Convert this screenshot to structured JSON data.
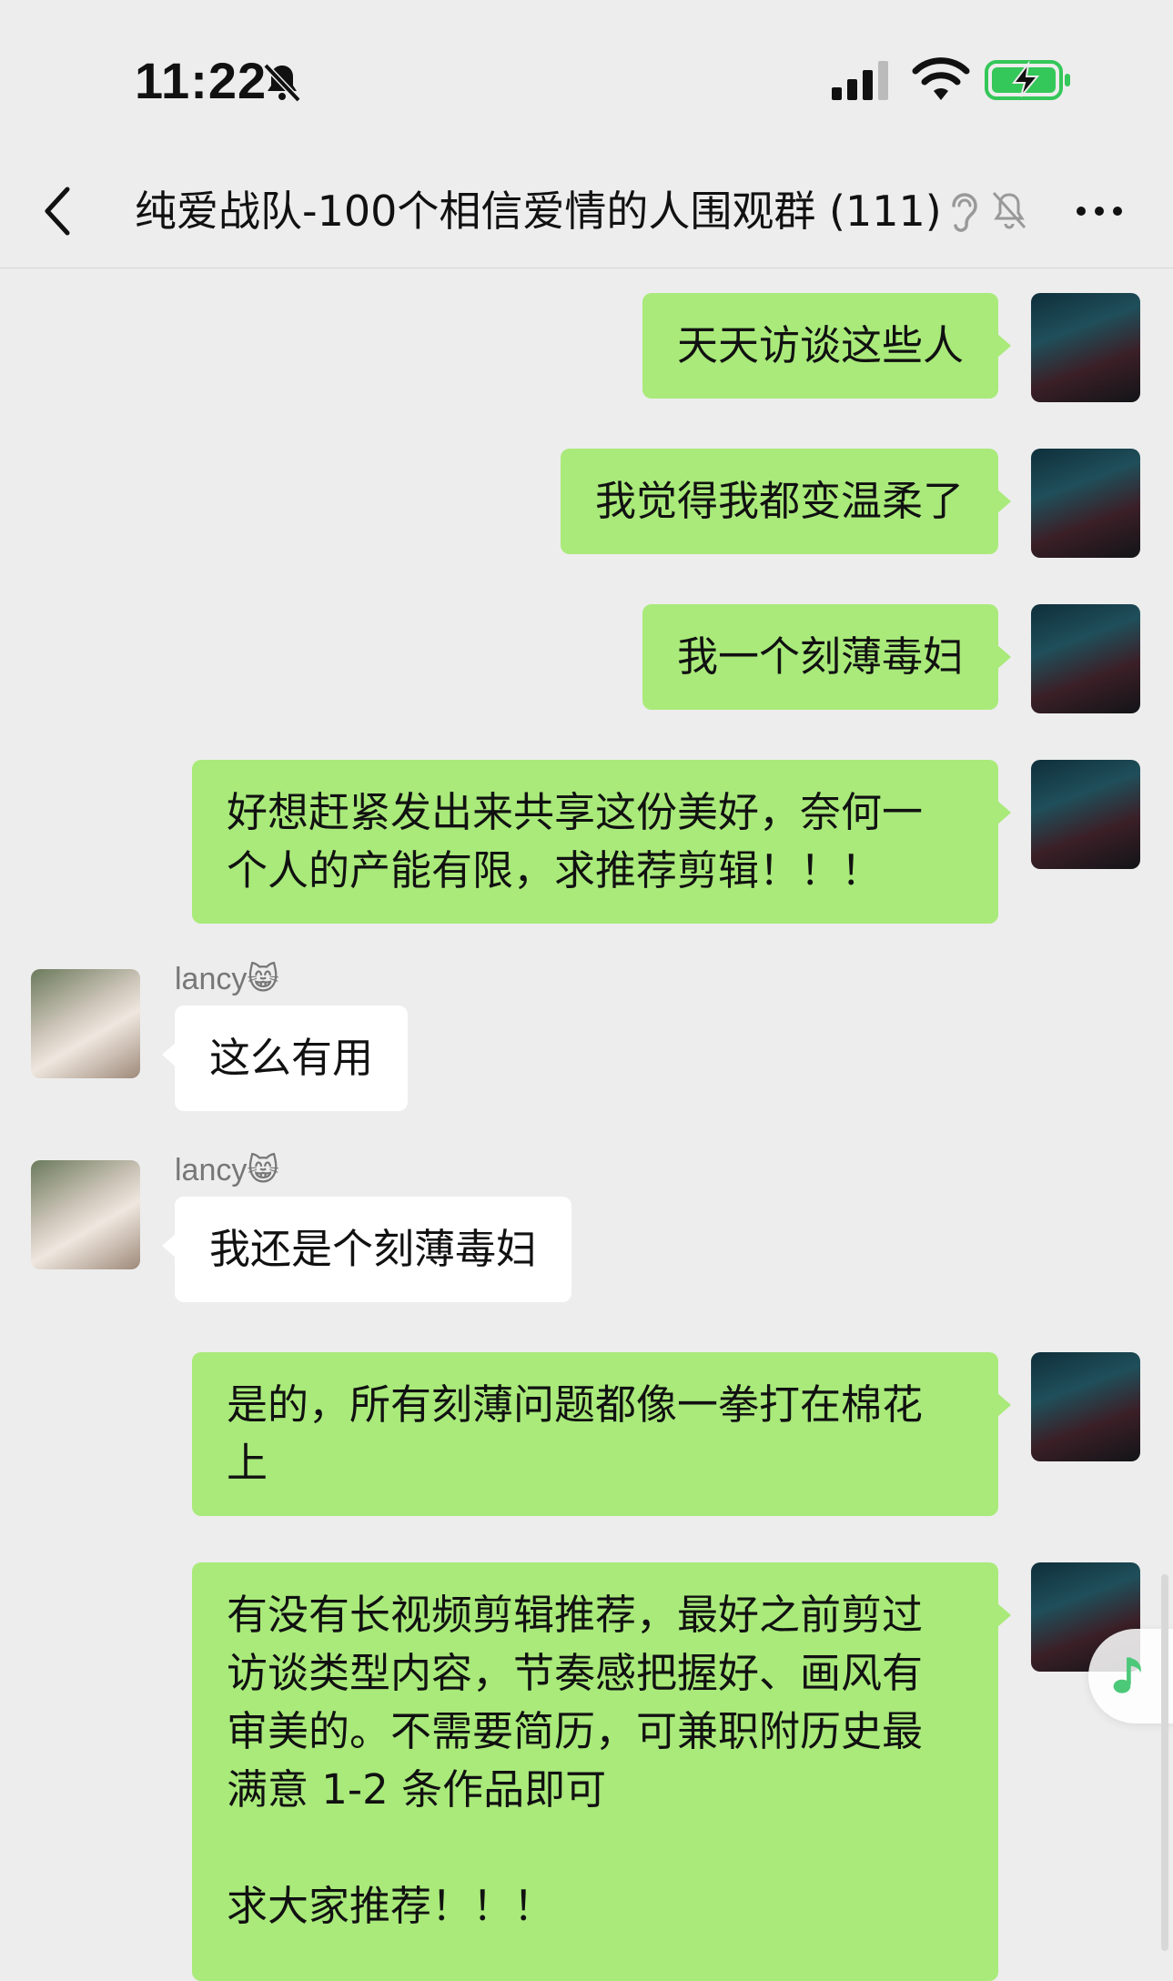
{
  "status_bar": {
    "time": "11:22",
    "icons": [
      "bell-muted-icon",
      "signal-icon",
      "wifi-icon",
      "battery-charging-icon"
    ]
  },
  "nav": {
    "back_icon": "chevron-left-icon",
    "title": "纯爱战队-100个相信爱情的人围观群 (111)",
    "status_icons": [
      "ear-icon",
      "mute-icon"
    ],
    "more_icon": "more-icon"
  },
  "messages": [
    {
      "from": "self",
      "text": "天天访谈这些人"
    },
    {
      "from": "self",
      "text": "我觉得我都变温柔了"
    },
    {
      "from": "self",
      "text": "我一个刻薄毒妇"
    },
    {
      "from": "self",
      "text": "好想赶紧发出来共享这份美好，奈何一\n个人的产能有限，求推荐剪辑！！！"
    },
    {
      "from": "other",
      "sender": "lancy",
      "sender_emoji": "😸",
      "text": "这么有用"
    },
    {
      "from": "other",
      "sender": "lancy",
      "sender_emoji": "😸",
      "text": "我还是个刻薄毒妇"
    },
    {
      "from": "self",
      "text": "是的，所有刻薄问题都像一拳打在棉花\n上"
    },
    {
      "from": "self",
      "text": "有没有长视频剪辑推荐，最好之前剪过\n访谈类型内容，节奏感把握好、画风有\n审美的。不需要简历，可兼职附历史最\n满意 1-2 条作品即可\n\n求大家推荐！！！"
    }
  ],
  "colors": {
    "background": "#ededed",
    "self_bubble": "#a9ea7a",
    "other_bubble": "#ffffff",
    "battery_green": "#34c759"
  },
  "floating_icon": "music-note-icon"
}
